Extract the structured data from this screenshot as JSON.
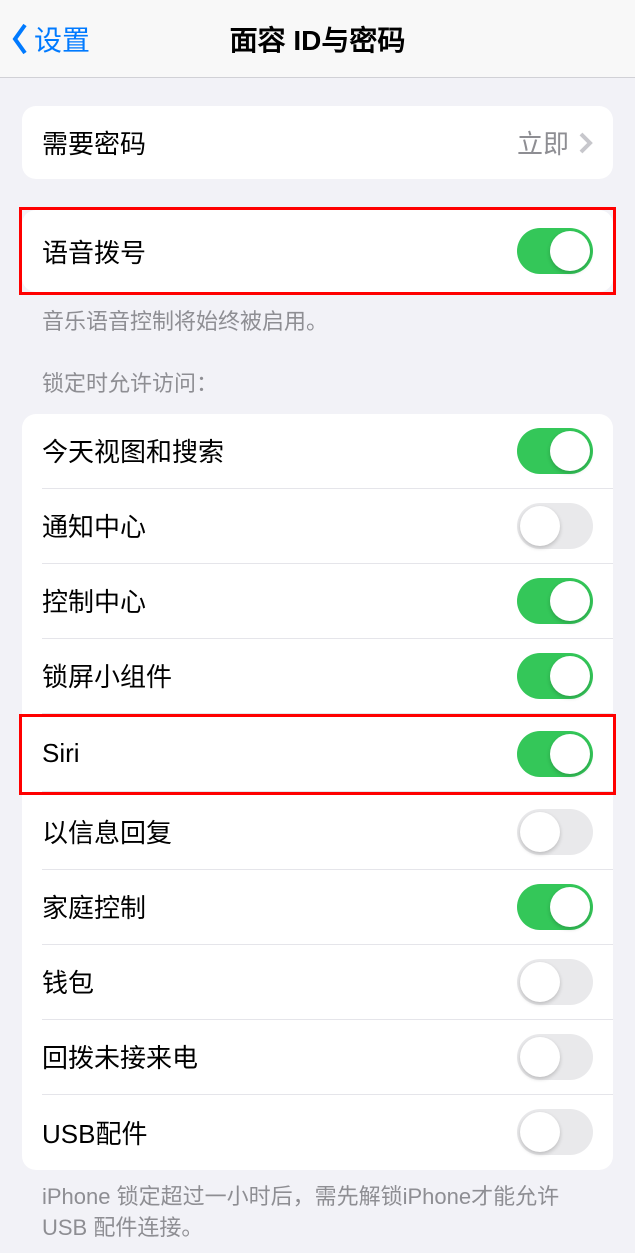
{
  "nav": {
    "back_label": "设置",
    "title": "面容 ID与密码"
  },
  "passcode_section": {
    "require_passcode_label": "需要密码",
    "require_passcode_value": "立即"
  },
  "voice_dial": {
    "label": "语音拨号",
    "enabled": true,
    "footer": "音乐语音控制将始终被启用。"
  },
  "lock_access": {
    "header": "锁定时允许访问：",
    "items": [
      {
        "label": "今天视图和搜索",
        "enabled": true,
        "highlighted": false
      },
      {
        "label": "通知中心",
        "enabled": false,
        "highlighted": false
      },
      {
        "label": "控制中心",
        "enabled": true,
        "highlighted": false
      },
      {
        "label": "锁屏小组件",
        "enabled": true,
        "highlighted": false
      },
      {
        "label": "Siri",
        "enabled": true,
        "highlighted": true
      },
      {
        "label": "以信息回复",
        "enabled": false,
        "highlighted": false
      },
      {
        "label": "家庭控制",
        "enabled": true,
        "highlighted": false
      },
      {
        "label": "钱包",
        "enabled": false,
        "highlighted": false
      },
      {
        "label": "回拨未接来电",
        "enabled": false,
        "highlighted": false
      },
      {
        "label": "USB配件",
        "enabled": false,
        "highlighted": false
      }
    ],
    "footer": "iPhone 锁定超过一小时后，需先解锁iPhone才能允许USB 配件连接。"
  }
}
